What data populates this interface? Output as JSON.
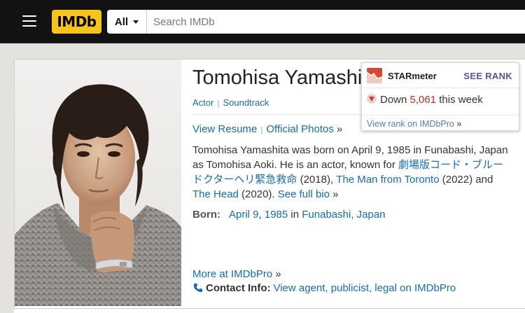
{
  "nav": {
    "logo": "IMDb",
    "search_category": "All",
    "search_placeholder": "Search IMDb"
  },
  "person": {
    "name": "Tomohisa Yamashita",
    "jobs": [
      "Actor",
      "Soundtrack"
    ],
    "actions": {
      "view_resume": "View Resume",
      "official_photos": "Official Photos",
      "raquo": "»"
    },
    "bio": {
      "text1": "Tomohisa Yamashita was born on April 9, 1985 in Funabashi, Japan as Tomohisa Aoki. He is an actor, known for ",
      "film1": "劇場版コード・ブルー　ドクターヘリ緊急救命",
      "year1": " (2018), ",
      "film2": "The Man from Toronto",
      "year2": " (2022) and ",
      "film3": "The Head",
      "year3": " (2020). ",
      "see_full_bio": "See full bio",
      "raquo": " »"
    },
    "born": {
      "label": "Born:",
      "date_month_day": "April 9",
      "comma": ", ",
      "year": "1985",
      "in": " in ",
      "place": "Funabashi, Japan"
    },
    "more_pro": "More at IMDbPro",
    "more_pro_raquo": "»",
    "contact": {
      "label": "Contact Info:",
      "link": "View agent, publicist, legal on IMDbPro"
    }
  },
  "starmeter": {
    "title": "STARmeter",
    "see_rank": "SEE RANK",
    "direction": "Down",
    "change": "5,061",
    "period": "this week",
    "footer_link": "View rank on IMDbPro",
    "footer_raquo": "»"
  },
  "colors": {
    "imdb_yellow": "#f5c518",
    "link_blue": "#136cb2",
    "starmeter_purple": "#5e4da0",
    "down_red": "#b0311e"
  },
  "icons": [
    "menu-icon",
    "caret-down-icon",
    "starmeter-icon",
    "down-arrow-icon",
    "phone-icon"
  ]
}
